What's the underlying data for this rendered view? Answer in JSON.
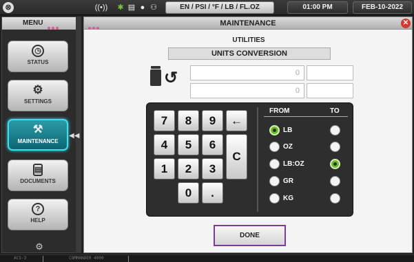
{
  "topbar": {
    "wifi_icon": "((•))",
    "units_label": "EN / PSI / °F / LB / FL.OZ",
    "time": "01:00 PM",
    "date": "FEB-10-2022"
  },
  "menu": {
    "title": "MENU",
    "items": [
      {
        "label": "STATUS",
        "icon": "gauge-icon"
      },
      {
        "label": "SETTINGS",
        "icon": "gear-icon"
      },
      {
        "label": "MAINTENANCE",
        "icon": "tools-icon"
      },
      {
        "label": "DOCUMENTS",
        "icon": "document-icon"
      },
      {
        "label": "HELP",
        "icon": "help-icon"
      }
    ],
    "active": "MAINTENANCE"
  },
  "panel": {
    "title": "MAINTENANCE",
    "subtitle": "UTILITIES",
    "section": "UNITS CONVERSION",
    "value_top": "0",
    "value_bottom": "0",
    "value_top_right": "",
    "value_bottom_right": ""
  },
  "keypad": {
    "keys": [
      "7",
      "8",
      "9",
      "←",
      "4",
      "5",
      "6",
      "C",
      "1",
      "2",
      "3",
      "0",
      "."
    ]
  },
  "units": {
    "from_header": "FROM",
    "to_header": "TO",
    "list": [
      "LB",
      "OZ",
      "LB:OZ",
      "GR",
      "KG"
    ],
    "from_selected": "LB",
    "to_selected": "LB:OZ"
  },
  "done_label": "DONE",
  "statusbar": {
    "left": "ACS-3",
    "mid": "COMMANDER 4000"
  },
  "colors": {
    "active_menu": "#1f8a96",
    "selected_radio": "#6fbc2a",
    "done_border": "#7e3a98",
    "close": "#d3392c"
  }
}
